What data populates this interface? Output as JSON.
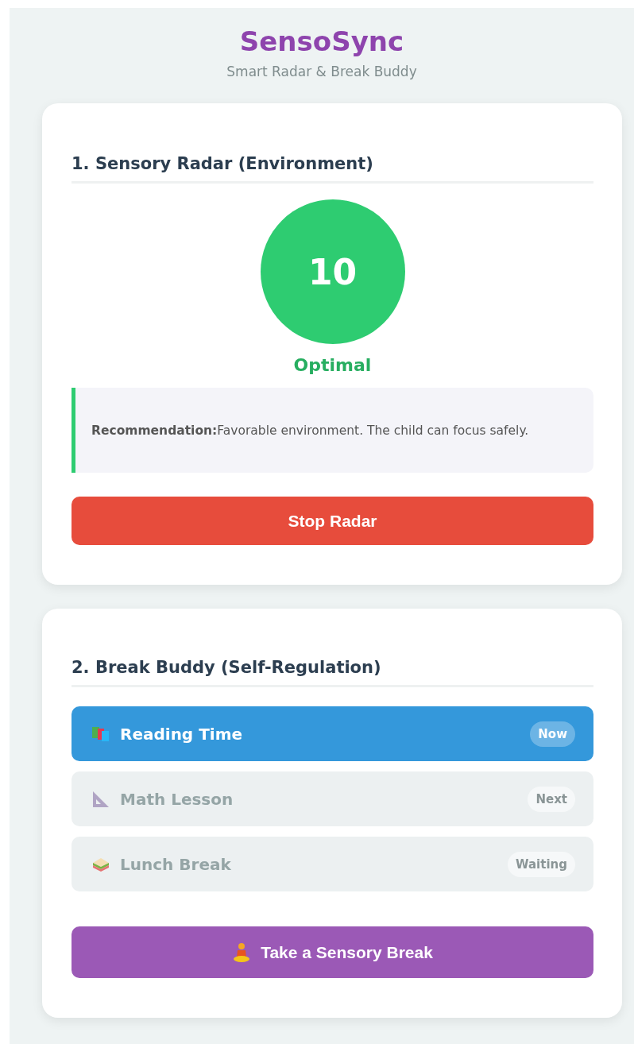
{
  "header": {
    "title": "SensoSync",
    "subtitle": "Smart Radar & Break Buddy"
  },
  "radar": {
    "heading": "1. Sensory Radar (Environment)",
    "score": "10",
    "kind": "optimal",
    "status": "Optimal",
    "recommendation": "**Recommendation:**Favorable environment. The child can focus safely.",
    "button": "Stop Radar"
  },
  "break_buddy": {
    "heading": "2. Break Buddy (Self-Regulation)",
    "schedule": [
      {
        "label": "Reading Time",
        "badge": "Now",
        "selected": true
      },
      {
        "label": "Math Lesson",
        "badge": "Next",
        "selected": false
      },
      {
        "label": "Lunch Break",
        "badge": "Waiting",
        "selected": false
      }
    ],
    "button": "Take a Sensory Break"
  }
}
